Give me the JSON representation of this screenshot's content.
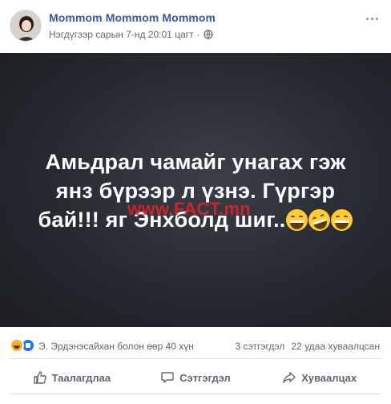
{
  "post": {
    "author": "Mommom Mommom Mommom",
    "timestamp": "Нэгдүгээр сарын 7-нд 20:01 цагт",
    "separator": "·",
    "privacy_icon": "globe-icon",
    "menu_icon": "more-options-icon",
    "image": {
      "text_lines": [
        "Амьдрал чамайг унагах гэж",
        "янз бүрээр л үзнэ. Гүргэр",
        "бай!!! яг Энхболд шиг.."
      ],
      "emojis": [
        "grinning-emoji",
        "rolling-laughing-emoji",
        "grinning-emoji"
      ],
      "watermark": "www.FACT.mn"
    },
    "reactions": {
      "icons": [
        "haha-reaction-icon",
        "like-reaction-icon"
      ],
      "names": "Э. Эрдэнэсайхан болон өөр 40 хүн",
      "comments": "3 сэтгэгдэл",
      "shares": "22 удаа хуваалцсан"
    },
    "actions": {
      "like": "Таалагдлаа",
      "comment": "Сэтгэгдэл",
      "share": "Хуваалцах"
    }
  },
  "colors": {
    "author_link": "#385898",
    "secondary_text": "#616770",
    "image_background": "#262930",
    "watermark": "#e8202a"
  }
}
